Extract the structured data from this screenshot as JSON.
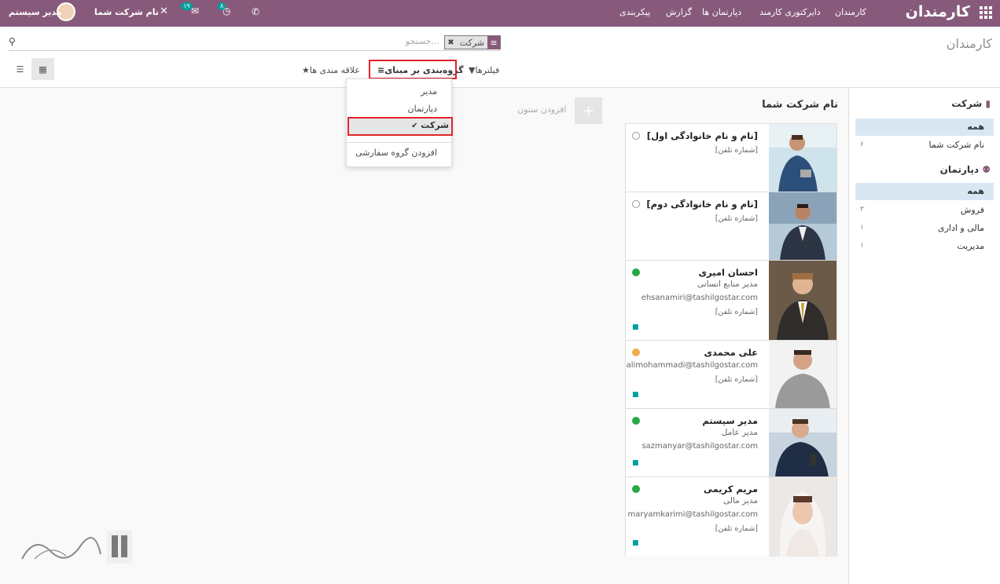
{
  "topbar": {
    "app_title": "کارمندان",
    "menu": [
      "کارمندان",
      "دایرکتوری کارمند",
      "دپارتمان ها",
      "گزارش",
      "پیکربندی"
    ],
    "company": "نام شرکت شما",
    "user": "مدیر سیستم",
    "activity_count": "۸",
    "messages_count": "۱۹"
  },
  "control": {
    "breadcrumb": "کارمندان",
    "search_placeholder": "جستجو...",
    "facet_value": "شرکت",
    "filters_label": "فیلترها",
    "groupby_label": "گروه‌بندی بر مبنای",
    "favorites_label": "علاقه مندی ها"
  },
  "groupby_menu": {
    "items": [
      "مدیر",
      "دپارتمان",
      "شرکت"
    ],
    "custom": "افزودن گروه سفارشی",
    "selected": "شرکت"
  },
  "sidepanel": {
    "company_header": "شرکت",
    "company_items": [
      {
        "label": "همه",
        "count": ""
      },
      {
        "label": "نام شرکت شما",
        "count": "۶"
      }
    ],
    "department_header": "دپارتمان",
    "department_items": [
      {
        "label": "همه",
        "count": ""
      },
      {
        "label": "فروش",
        "count": "۳"
      },
      {
        "label": "مالی و اداری",
        "count": "۱"
      },
      {
        "label": "مدیریت",
        "count": "۱"
      }
    ]
  },
  "kanban": {
    "column_title": "نام شرکت شما",
    "add_column": "افزودن ستون",
    "cards": [
      {
        "name": "[نام و نام خانوادگی اول]",
        "job": "",
        "email": "",
        "phone": "[شماره تلفن]",
        "status": "offline"
      },
      {
        "name": "[نام و نام خانوادگی دوم]",
        "job": "",
        "email": "",
        "phone": "[شماره تلفن]",
        "status": "offline"
      },
      {
        "name": "احسان امیری",
        "job": "مدیر منابع انسانی",
        "email": "ehsanamiri@tashilgostar.com",
        "phone": "[شماره تلفن]",
        "status": "online"
      },
      {
        "name": "علی محمدی",
        "job": "",
        "email": "alimohammadi@tashilgostar.com",
        "phone": "[شماره تلفن]",
        "status": "away"
      },
      {
        "name": "مدیر سیستم",
        "job": "مدیر عامل",
        "email": "sazmanyar@tashilgostar.com",
        "phone": "",
        "status": "online"
      },
      {
        "name": "مریم کریمی",
        "job": "مدیر مالی",
        "email": "maryamkarimi@tashilgostar.com",
        "phone": "[شماره تلفن]",
        "status": "online"
      }
    ]
  },
  "colors": {
    "brand": "#875a7b",
    "online": "#28a745",
    "away": "#f0ad4e",
    "highlight": "#e0242b"
  }
}
